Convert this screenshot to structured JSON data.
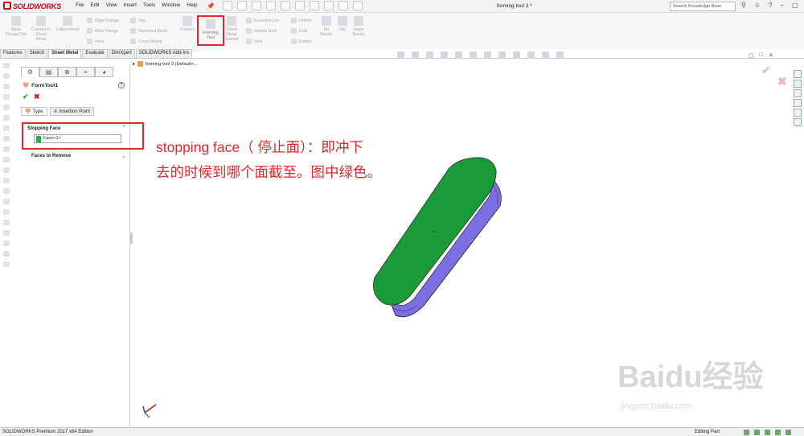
{
  "app": {
    "logo": "SOLIDWORKS",
    "document_title": "forming tool 3 *",
    "menu": [
      "File",
      "Edit",
      "View",
      "Insert",
      "Tools",
      "Window",
      "Help"
    ],
    "search_placeholder": "Search Knowledge Base"
  },
  "commands": {
    "base_flange": "Base Flange/Tab",
    "convert_to_sheet_metal": "Convert to Sheet Metal",
    "lofted_bend": "Lofted-Bend",
    "edge_flange": "Edge Flange",
    "miter_flange": "Miter Flange",
    "hem": "Hem",
    "jog": "Jog",
    "sketched_bend": "Sketched Bend",
    "cross_break": "Cross-Break",
    "corners": "Corners",
    "forming_tool": "Forming Tool",
    "sheet_metal_gusset": "Sheet Metal Gusset",
    "extruded_cut": "Extruded Cut",
    "simple_hole": "Simple Hole",
    "vent": "Vent",
    "unfold": "Unfold",
    "fold": "Fold",
    "flatten": "Flatten",
    "no_bends": "No Bends",
    "rip": "Rip",
    "insert_bends": "Insert Bends"
  },
  "tabs": [
    {
      "label": "Features",
      "active": false
    },
    {
      "label": "Sketch",
      "active": false
    },
    {
      "label": "Sheet Metal",
      "active": true
    },
    {
      "label": "Evaluate",
      "active": false
    },
    {
      "label": "DimXpert",
      "active": false
    },
    {
      "label": "SOLIDWORKS Add-Ins",
      "active": false
    }
  ],
  "property_manager": {
    "title": "FormTool1",
    "help": "?",
    "ok": "✔",
    "cancel": "✖",
    "sub_tabs": [
      "Type",
      "Insertion Point"
    ],
    "stopping_face": {
      "label": "Stopping Face",
      "value": "Face<1>",
      "swatch_color": "#1bb34a"
    },
    "faces_to_remove": {
      "label": "Faces to Remove"
    }
  },
  "graphics": {
    "tree_path": "forming tool 3  (Default<...",
    "annotation_line1": "stopping face（ 停止面）：即冲下",
    "annotation_line2": "去的时候到哪个面截至。图中绿色。",
    "face_color": "#1a9b3a",
    "body_color": "#7a6fe3"
  },
  "watermark": {
    "line1": "Baidu经验",
    "line2": "jingyan.baidu.com"
  },
  "status": {
    "left": "SOLIDWORKS Premium 2017 x64 Edition",
    "right": "Editing Part"
  }
}
